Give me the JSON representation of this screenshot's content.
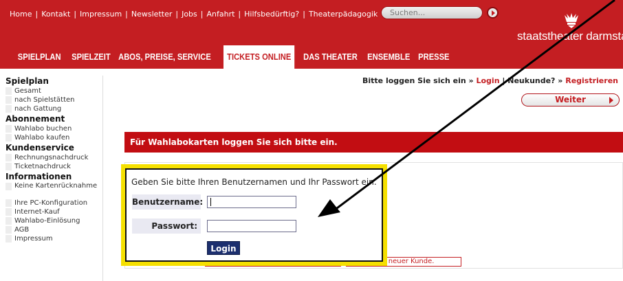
{
  "header": {
    "top_links": [
      "Home",
      "Kontakt",
      "Impressum",
      "Newsletter",
      "Jobs",
      "Anfahrt",
      "Hilfsbedürftig?",
      "Theaterpädagogik"
    ],
    "search_placeholder": "Suchen...",
    "logo_text": "staatstheater darmstadt",
    "nav": [
      "SPIELPLAN",
      "SPIELZEIT",
      "ABOS, PREISE, SERVICE",
      "TICKETS ONLINE",
      "DAS THEATER",
      "ENSEMBLE",
      "PRESSE"
    ],
    "nav_active": "TICKETS ONLINE"
  },
  "sidebar": {
    "sections": [
      {
        "title": "Spielplan",
        "items": [
          "Gesamt",
          "nach Spielstätten",
          "nach Gattung"
        ]
      },
      {
        "title": "Abonnement",
        "items": [
          "Wahlabo buchen",
          "Wahlabo kaufen"
        ]
      },
      {
        "title": "Kundenservice",
        "items": [
          "Rechnungsnachdruck",
          "Ticketnachdruck"
        ]
      },
      {
        "title": "Informationen",
        "items": [
          "Keine Kartenrücknahme",
          "Ihre PC-Konfiguration",
          "Internet-Kauf",
          "Wahlabo-Einlösung",
          "AGB",
          "Impressum"
        ]
      }
    ]
  },
  "main": {
    "login_prompt": "Bitte loggen Sie sich ein »",
    "login_link": "Login",
    "separator": "|",
    "new_customer_prompt": "Neukunde? »",
    "register_link": "Registrieren",
    "weiter_label": "Weiter",
    "alert_text": "Für Wahlabokarten loggen Sie sich bitte ein.",
    "login_box": {
      "hint": "Geben Sie bitte Ihren Benutzernamen und Ihr Passwort ein.",
      "username_label": "Benutzername:",
      "password_label": "Passwort:",
      "username_value": "",
      "password_value": "",
      "submit_label": "Login"
    },
    "new_customer_link": "in ein neuer Kunde."
  },
  "colors": {
    "brand_red": "#c41e22",
    "highlight_yellow": "#f5e000",
    "login_button_blue": "#1c2f6e"
  }
}
